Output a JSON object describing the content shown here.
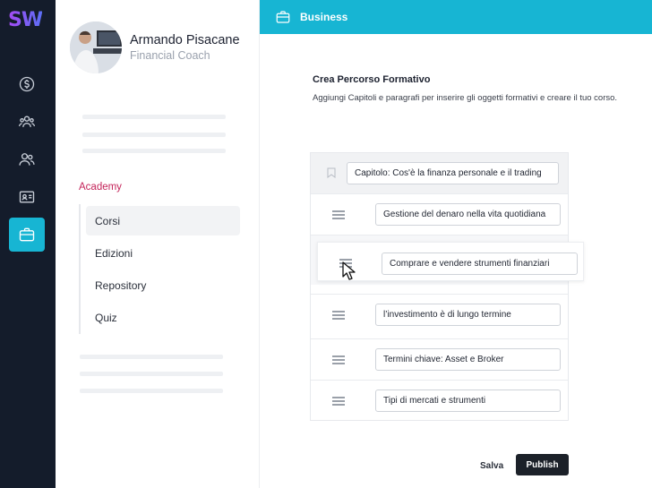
{
  "app": {
    "logo_text": "SW"
  },
  "rail": {
    "items": [
      {
        "icon": "dollar-icon",
        "active": false
      },
      {
        "icon": "community-icon",
        "active": false
      },
      {
        "icon": "users-icon",
        "active": false
      },
      {
        "icon": "id-card-icon",
        "active": false
      },
      {
        "icon": "briefcase-icon",
        "active": true
      }
    ]
  },
  "profile": {
    "name": "Armando Pisacane",
    "role": "Financial Coach"
  },
  "sidebar": {
    "section_title": "Academy",
    "items": [
      {
        "label": "Corsi",
        "active": true
      },
      {
        "label": "Edizioni",
        "active": false
      },
      {
        "label": "Repository",
        "active": false
      },
      {
        "label": "Quiz",
        "active": false
      }
    ]
  },
  "header": {
    "title": "Business"
  },
  "main": {
    "title": "Crea Percorso Formativo",
    "subtitle": "Aggiungi Capitoli e paragrafi per inserire gli oggetti formativi e creare il tuo corso.",
    "chapter": "Capitolo: Cos'è la finanza personale e il trading",
    "paragraphs": [
      "Gestione del denaro nella vita quotidiana",
      "Comprare e vendere strumenti finanziari",
      "l’investimento è di lungo termine",
      "Termini chiave: Asset e Broker",
      "Tipi di mercati e strumenti"
    ]
  },
  "actions": {
    "save_label": "Salva",
    "publish_label": "Publish"
  },
  "colors": {
    "accent": "#17b5d3",
    "rail_bg": "#141c2b",
    "section": "#c4245a"
  }
}
